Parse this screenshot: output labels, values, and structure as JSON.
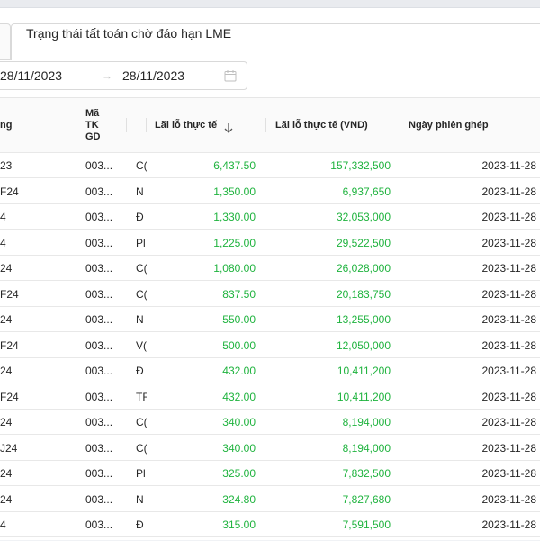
{
  "tab": {
    "active_label": "Trạng thái tất toán chờ đáo hạn LME"
  },
  "date_range": {
    "start": "28/11/2023",
    "separator": "→",
    "end": "28/11/2023",
    "icon": "calendar-icon"
  },
  "table": {
    "columns": {
      "contract": "ng",
      "account_line1": "Mã",
      "account_line2": "TK",
      "account_line3": "GD",
      "pnl": "Lãi lỗ thực tế",
      "pnl_vnd": "Lãi lỗ thực tế (VND)",
      "match_date": "Ngày phiên ghép"
    },
    "sort_icon": "arrow-down-icon",
    "rows": [
      {
        "contract": "23",
        "account": "003...",
        "product": "C(",
        "pnl": "6,437.50",
        "pnl_vnd": "157,332,500",
        "date": "2023-11-28"
      },
      {
        "contract": "F24",
        "account": "003...",
        "product": "N",
        "pnl": "1,350.00",
        "pnl_vnd": "6,937,650",
        "date": "2023-11-28"
      },
      {
        "contract": "4",
        "account": "003...",
        "product": "Đ",
        "pnl": "1,330.00",
        "pnl_vnd": "32,053,000",
        "date": "2023-11-28"
      },
      {
        "contract": "4",
        "account": "003...",
        "product": "Pl",
        "pnl": "1,225.00",
        "pnl_vnd": "29,522,500",
        "date": "2023-11-28"
      },
      {
        "contract": "24",
        "account": "003...",
        "product": "C(",
        "pnl": "1,080.00",
        "pnl_vnd": "26,028,000",
        "date": "2023-11-28"
      },
      {
        "contract": "F24",
        "account": "003...",
        "product": "C(",
        "pnl": "837.50",
        "pnl_vnd": "20,183,750",
        "date": "2023-11-28"
      },
      {
        "contract": "24",
        "account": "003...",
        "product": "N",
        "pnl": "550.00",
        "pnl_vnd": "13,255,000",
        "date": "2023-11-28"
      },
      {
        "contract": "F24",
        "account": "003...",
        "product": "V(",
        "pnl": "500.00",
        "pnl_vnd": "12,050,000",
        "date": "2023-11-28"
      },
      {
        "contract": "24",
        "account": "003...",
        "product": "Đ",
        "pnl": "432.00",
        "pnl_vnd": "10,411,200",
        "date": "2023-11-28"
      },
      {
        "contract": "F24",
        "account": "003...",
        "product": "TF",
        "pnl": "432.00",
        "pnl_vnd": "10,411,200",
        "date": "2023-11-28"
      },
      {
        "contract": "24",
        "account": "003...",
        "product": "C(",
        "pnl": "340.00",
        "pnl_vnd": "8,194,000",
        "date": "2023-11-28"
      },
      {
        "contract": "J24",
        "account": "003...",
        "product": "C(",
        "pnl": "340.00",
        "pnl_vnd": "8,194,000",
        "date": "2023-11-28"
      },
      {
        "contract": "24",
        "account": "003...",
        "product": "Pl",
        "pnl": "325.00",
        "pnl_vnd": "7,832,500",
        "date": "2023-11-28"
      },
      {
        "contract": "24",
        "account": "003...",
        "product": "N",
        "pnl": "324.80",
        "pnl_vnd": "7,827,680",
        "date": "2023-11-28"
      },
      {
        "contract": "4",
        "account": "003...",
        "product": "Đ",
        "pnl": "315.00",
        "pnl_vnd": "7,591,500",
        "date": "2023-11-28"
      }
    ]
  },
  "colors": {
    "positive": "#1fb33e",
    "border": "#e8e8e8",
    "header_bg": "#fafafa"
  }
}
